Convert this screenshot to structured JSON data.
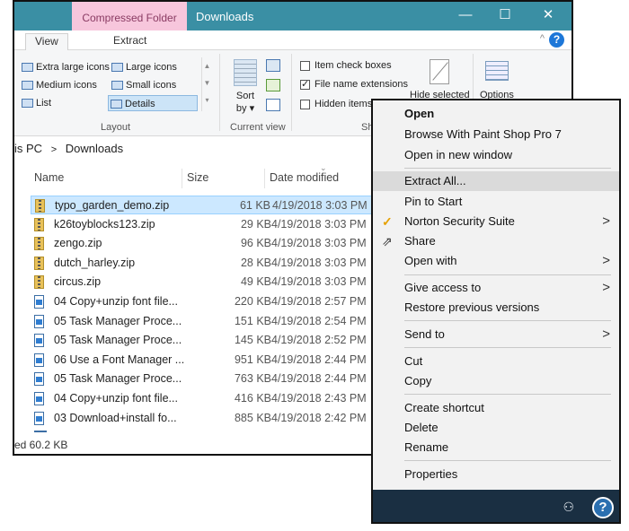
{
  "window": {
    "context_label": "Compressed Folder Tools",
    "title": "Downloads",
    "minimize": "—",
    "maximize": "☐",
    "close": "✕"
  },
  "tabs": {
    "view": "View",
    "extract": "Extract",
    "collapse": "^",
    "help": "?"
  },
  "ribbon": {
    "layout": {
      "items": [
        "Extra large icons",
        "Large icons",
        "Medium icons",
        "Small icons",
        "List",
        "Details"
      ],
      "group_label": "Layout"
    },
    "current_view": {
      "sort_label": "Sort by ▾",
      "group_label": "Current view"
    },
    "show_hide": {
      "item_check_boxes": "Item check boxes",
      "file_name_extensions": "File name extensions",
      "hidden_items": "Hidden items",
      "hide_selected": "Hide selected",
      "group_label": "Sh"
    },
    "options": "Options"
  },
  "address": {
    "pc": "is PC",
    "sep": ">",
    "folder": "Downloads"
  },
  "columns": {
    "name": "Name",
    "size": "Size",
    "date": "Date modified"
  },
  "files": [
    {
      "name": "typo_garden_demo.zip",
      "size": "61 KB",
      "date": "4/19/2018 3:03 PM",
      "type": "zip",
      "selected": true
    },
    {
      "name": "k26toyblocks123.zip",
      "size": "29 KB",
      "date": "4/19/2018 3:03 PM",
      "type": "zip"
    },
    {
      "name": "zengo.zip",
      "size": "96 KB",
      "date": "4/19/2018 3:03 PM",
      "type": "zip"
    },
    {
      "name": "dutch_harley.zip",
      "size": "28 KB",
      "date": "4/19/2018 3:03 PM",
      "type": "zip"
    },
    {
      "name": "circus.zip",
      "size": "49 KB",
      "date": "4/19/2018 3:03 PM",
      "type": "zip"
    },
    {
      "name": "04 Copy+unzip font file...",
      "size": "220 KB",
      "date": "4/19/2018 2:57 PM",
      "type": "doc"
    },
    {
      "name": "05 Task Manager Proce...",
      "size": "151 KB",
      "date": "4/19/2018 2:54 PM",
      "type": "doc"
    },
    {
      "name": "05 Task Manager Proce...",
      "size": "145 KB",
      "date": "4/19/2018 2:52 PM",
      "type": "doc"
    },
    {
      "name": "06 Use a Font Manager ...",
      "size": "951 KB",
      "date": "4/19/2018 2:44 PM",
      "type": "doc"
    },
    {
      "name": "05 Task Manager Proce...",
      "size": "763 KB",
      "date": "4/19/2018 2:44 PM",
      "type": "doc"
    },
    {
      "name": "04 Copy+unzip font file...",
      "size": "416 KB",
      "date": "4/19/2018 2:43 PM",
      "type": "doc"
    },
    {
      "name": "03 Download+install fo...",
      "size": "885 KB",
      "date": "4/19/2018 2:42 PM",
      "type": "doc"
    }
  ],
  "status": "ed  60.2 KB",
  "context_menu": {
    "open": "Open",
    "browse_psp": "Browse With Paint Shop Pro 7",
    "open_new_window": "Open in new window",
    "extract_all": "Extract All...",
    "pin_to_start": "Pin to Start",
    "norton": "Norton Security Suite",
    "share": "Share",
    "open_with": "Open with",
    "give_access": "Give access to",
    "restore_prev": "Restore previous versions",
    "send_to": "Send to",
    "cut": "Cut",
    "copy": "Copy",
    "create_shortcut": "Create shortcut",
    "delete": "Delete",
    "rename": "Rename",
    "properties": "Properties",
    "submenu_arrow": ">"
  },
  "taskbar": {
    "help": "?"
  },
  "colors": {
    "titlebar": "#3a8fa4",
    "context_tab": "#f7c6dc",
    "selection": "#cce8ff",
    "menu_bg": "#f2f2f2",
    "taskbar": "#1a2f42"
  }
}
